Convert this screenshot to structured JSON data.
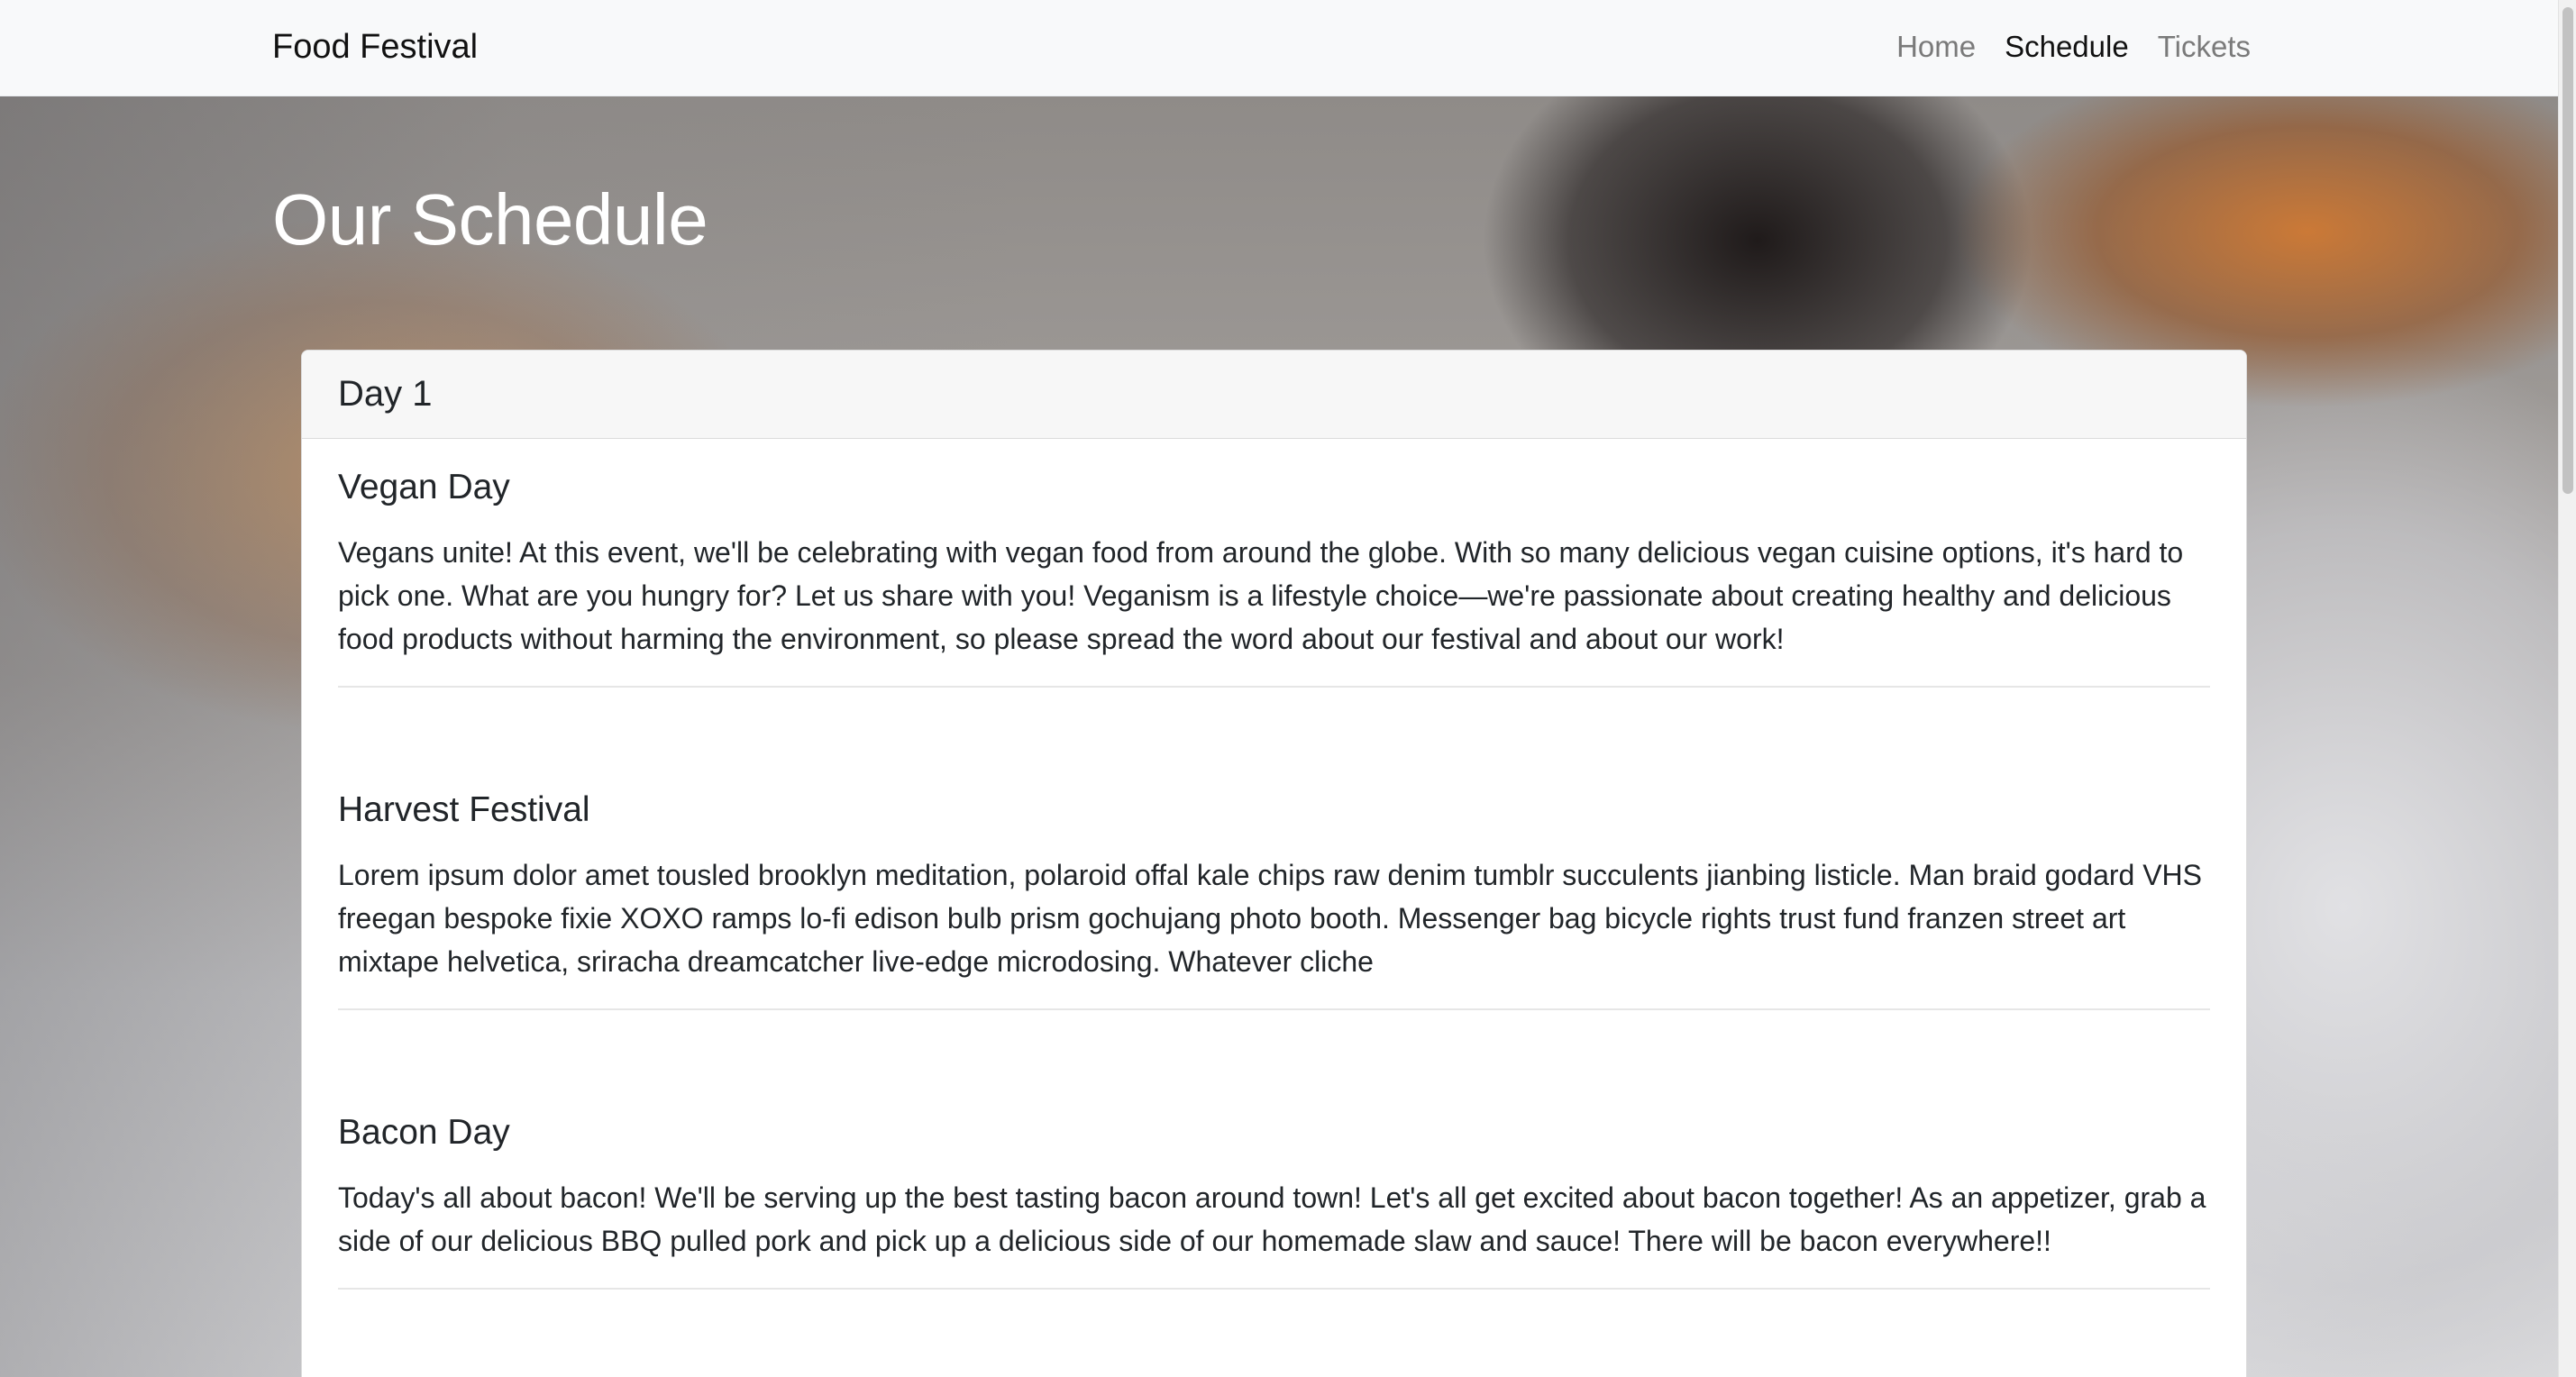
{
  "navbar": {
    "brand": "Food Festival",
    "links": [
      {
        "label": "Home",
        "active": false
      },
      {
        "label": "Schedule",
        "active": true
      },
      {
        "label": "Tickets",
        "active": false
      }
    ]
  },
  "main": {
    "title": "Our Schedule",
    "card": {
      "header": "Day 1",
      "events": [
        {
          "title": "Vegan Day",
          "description": "Vegans unite! At this event, we'll be celebrating with vegan food from around the globe. With so many delicious vegan cuisine options, it's hard to pick one. What are you hungry for? Let us share with you! Veganism is a lifestyle choice—we're passionate about creating healthy and delicious food products without harming the environment, so please spread the word about our festival and about our work!"
        },
        {
          "title": "Harvest Festival",
          "description": "Lorem ipsum dolor amet tousled brooklyn meditation, polaroid offal kale chips raw denim tumblr succulents jianbing listicle. Man braid godard VHS freegan bespoke fixie XOXO ramps lo-fi edison bulb prism gochujang photo booth. Messenger bag bicycle rights trust fund franzen street art mixtape helvetica, sriracha dreamcatcher live-edge microdosing. Whatever cliche"
        },
        {
          "title": "Bacon Day",
          "description": "Today's all about bacon! We'll be serving up the best tasting bacon around town! Let's all get excited about bacon together! As an appetizer, grab a side of our delicious BBQ pulled pork and pick up a delicious side of our homemade slaw and sauce! There will be bacon everywhere!!"
        }
      ]
    }
  },
  "colors": {
    "navbar_bg": "#f8f9fa",
    "nav_link": "#7a7a7a",
    "nav_link_active": "#111111",
    "title_text": "#ffffff",
    "card_header_bg": "#f7f7f7"
  }
}
